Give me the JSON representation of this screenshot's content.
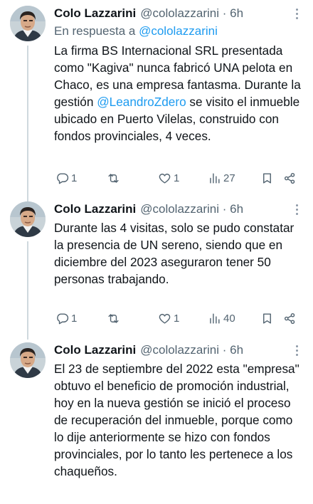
{
  "tweets": [
    {
      "name": "Colo Lazzarini",
      "handle": "@cololazzarini",
      "time": " · 6h",
      "reply_prefix": "En respuesta a ",
      "reply_mention": "@cololazzarini",
      "text_a": "La firma BS Internacional SRL presentada como \"Kagiva\" nunca fabricó UNA pelota en Chaco, es una empresa fantasma. Durante la gestión ",
      "mention": "@LeandroZdero",
      "text_b": " se visito el inmueble ubicado en Puerto Vilelas, construido con fondos provinciales, 4 veces.",
      "replies": "1",
      "retweets": "",
      "likes": "1",
      "views": "27"
    },
    {
      "name": "Colo Lazzarini",
      "handle": "@cololazzarini",
      "time": " · 6h",
      "text": "Durante las 4 visitas, solo se pudo constatar la presencia de UN sereno, siendo que en diciembre del 2023 aseguraron tener 50 personas trabajando.",
      "replies": "1",
      "retweets": "",
      "likes": "1",
      "views": "40"
    },
    {
      "name": "Colo Lazzarini",
      "handle": "@cololazzarini",
      "time": " · 6h",
      "text": "El 23 de septiembre del 2022 esta \"empresa\" obtuvo el beneficio de promoción industrial, hoy en la nueva gestión se inició el proceso de recuperación del inmueble, porque como lo dije anteriormente se hizo con fondos provinciales, por lo tanto les pertenece a los chaqueños."
    }
  ],
  "colors": {
    "link": "#1d9bf0",
    "muted": "#536471",
    "text": "#0f1419",
    "thread": "#cfd9de"
  }
}
